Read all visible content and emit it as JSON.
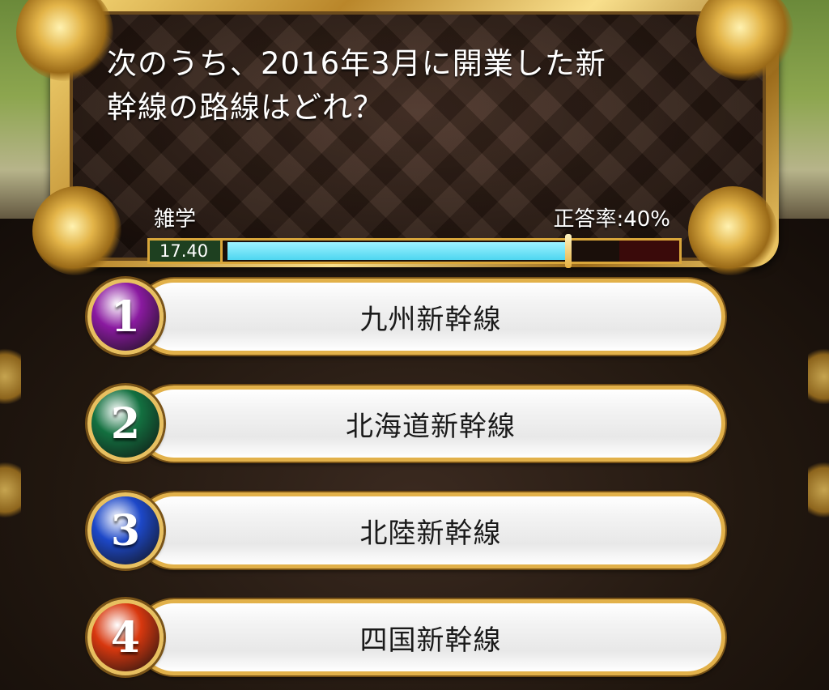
{
  "question": {
    "line1": "次のうち、2016年3月に開業した新",
    "line2": "幹線の路線はどれ？",
    "category": "雑学",
    "correct_rate": "正答率:40%"
  },
  "timer": {
    "value": "17.40",
    "remaining_fraction": 0.87
  },
  "answers": [
    {
      "number": "1",
      "label": "九州新幹線",
      "color": "#8a1aa0"
    },
    {
      "number": "2",
      "label": "北海道新幹線",
      "color": "#137040"
    },
    {
      "number": "3",
      "label": "北陸新幹線",
      "color": "#1d48c8"
    },
    {
      "number": "4",
      "label": "四国新幹線",
      "color": "#d8380f"
    }
  ]
}
